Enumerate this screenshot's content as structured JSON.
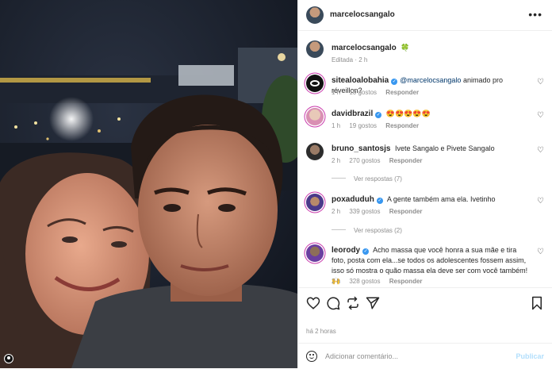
{
  "post": {
    "author": "marcelocsangalo",
    "caption_emoji": "🍀",
    "edited_time": "Editada · 2 h",
    "date": "há 2 horas"
  },
  "comments": [
    {
      "user": "sitealoalobahia",
      "verified": true,
      "mention": "@marcelocsangalo",
      "text": "animado pro réveillon?",
      "time": "1 h",
      "likes": "10 gostos",
      "reply": "Responder"
    },
    {
      "user": "davidbrazil",
      "verified": true,
      "text": "😍😍😍😍😍",
      "time": "1 h",
      "likes": "19 gostos",
      "reply": "Responder"
    },
    {
      "user": "bruno_santosjs",
      "verified": false,
      "text": "Ivete Sangalo e Pivete Sangalo",
      "time": "2 h",
      "likes": "270 gostos",
      "reply": "Responder",
      "view_replies": "Ver respostas (7)"
    },
    {
      "user": "poxaduduh",
      "verified": true,
      "text": "A gente também ama ela. Ivetinho",
      "time": "2 h",
      "likes": "339 gostos",
      "reply": "Responder",
      "view_replies": "Ver respostas (2)"
    },
    {
      "user": "leorody",
      "verified": true,
      "text": "Acho massa que você honra a sua mãe e tira foto, posta com ela...se todos os adolescentes fossem assim, isso só mostra o quão massa ela deve ser com você também! 🙌",
      "time": "2 h",
      "likes": "328 gostos",
      "reply": "Responder"
    }
  ],
  "footer": {
    "comment_placeholder": "Adicionar comentário...",
    "publish_label": "Publicar"
  },
  "icons": {
    "more": "more-options-icon",
    "like": "heart-icon",
    "comment": "comment-icon",
    "share": "share-icon",
    "send": "send-icon",
    "save": "bookmark-icon",
    "emoji": "emoji-icon",
    "tag": "user-tag-icon"
  },
  "colors": {
    "verified": "#3897f0",
    "mention": "#00376b",
    "publish_disabled": "#b2dffc",
    "meta": "#8e8e8e"
  }
}
